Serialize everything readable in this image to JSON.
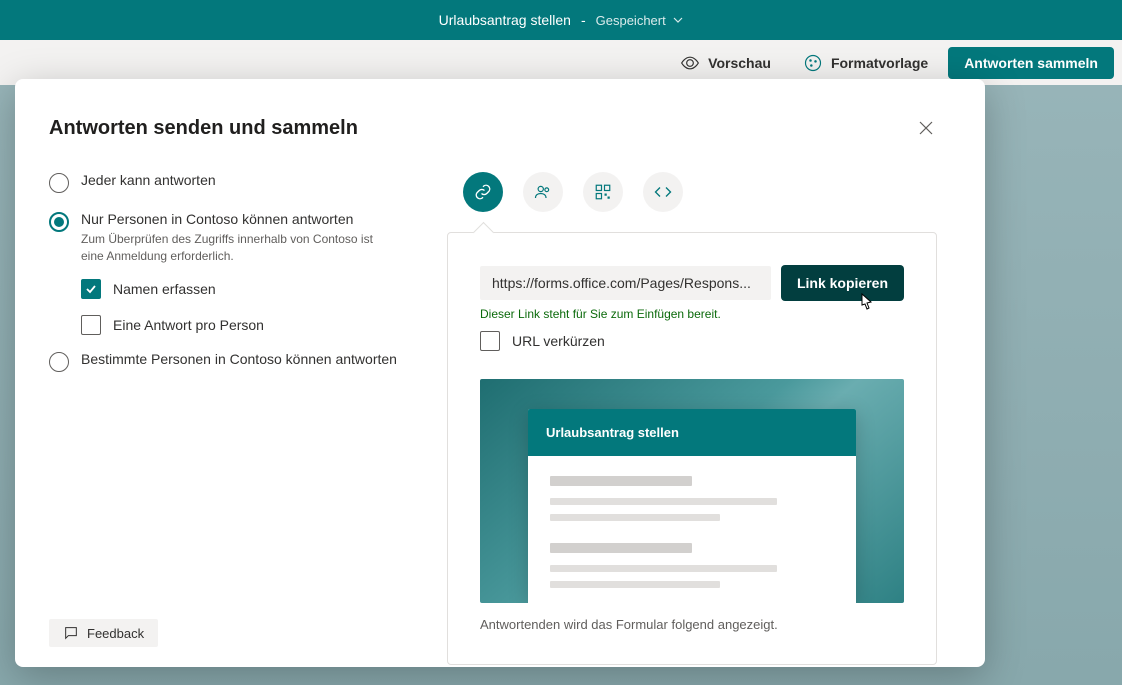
{
  "topbar": {
    "title": "Urlaubsantrag stellen",
    "separator": "-",
    "saved": "Gespeichert"
  },
  "toolbar": {
    "preview": "Vorschau",
    "theme": "Formatvorlage",
    "collect": "Antworten sammeln"
  },
  "dialog": {
    "title": "Antworten senden und sammeln",
    "options": {
      "anyone": "Jeder kann antworten",
      "org": "Nur Personen in Contoso können antworten",
      "org_desc": "Zum Überprüfen des Zugriffs innerhalb von Contoso ist eine Anmeldung erforderlich.",
      "record_name": "Namen erfassen",
      "one_response": "Eine Antwort pro Person",
      "specific": "Bestimmte Personen in Contoso können antworten"
    },
    "share": {
      "url": "https://forms.office.com/Pages/Respons...",
      "copy": "Link kopieren",
      "status": "Dieser Link steht für Sie zum Einfügen bereit.",
      "shorten": "URL verkürzen",
      "preview_title": "Urlaubsantrag stellen",
      "preview_caption": "Antwortenden wird das Formular folgend angezeigt."
    },
    "feedback": "Feedback"
  }
}
